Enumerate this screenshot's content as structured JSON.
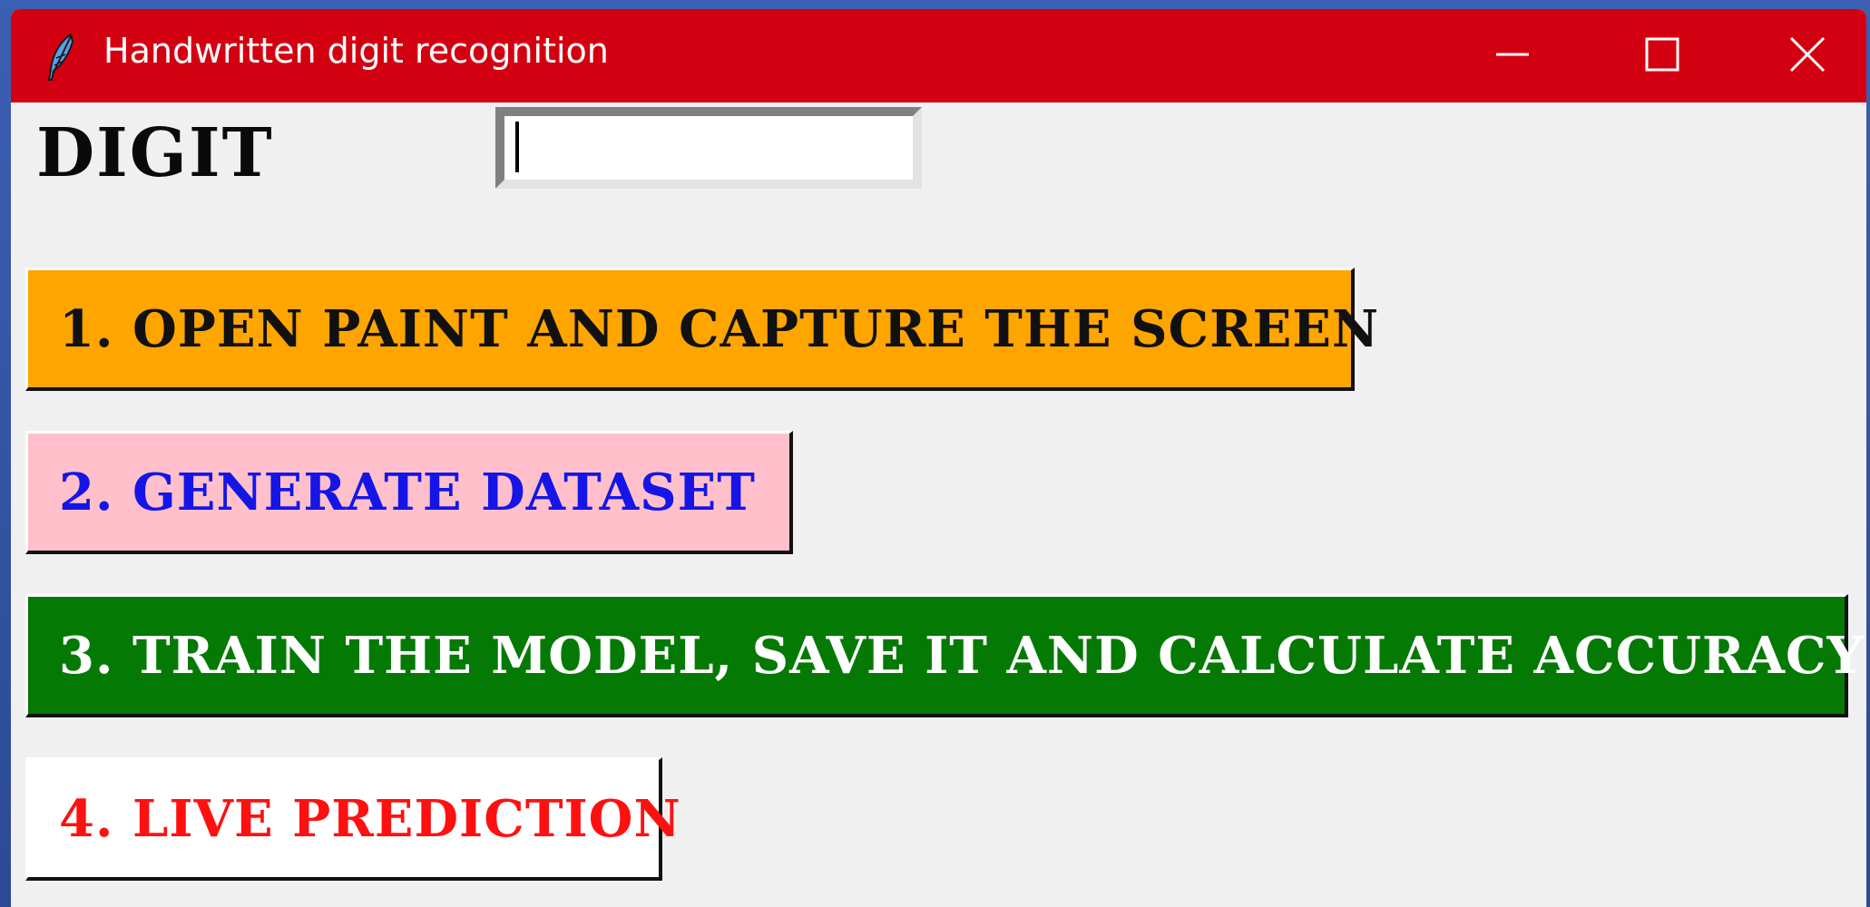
{
  "window": {
    "title": "Handwritten digit recognition",
    "icon": "feather-icon",
    "titlebar_color": "#d30011",
    "controls": [
      "minimize-icon",
      "maximize-icon",
      "close-icon"
    ]
  },
  "form": {
    "digit_label": "DIGIT",
    "digit_value": "",
    "digit_placeholder": ""
  },
  "buttons": [
    {
      "label": "1. Open paint and capture the screen",
      "bg": "#ffa500",
      "fg": "#111111"
    },
    {
      "label": "2. Generate dataset",
      "bg": "#ffc0cb",
      "fg": "#1515e6"
    },
    {
      "label": "3. Train the model, save it and calculate accuracy",
      "bg": "#047a05",
      "fg": "#ffffff"
    },
    {
      "label": "4. Live prediction",
      "bg": "#ffffff",
      "fg": "#ff1010"
    }
  ]
}
